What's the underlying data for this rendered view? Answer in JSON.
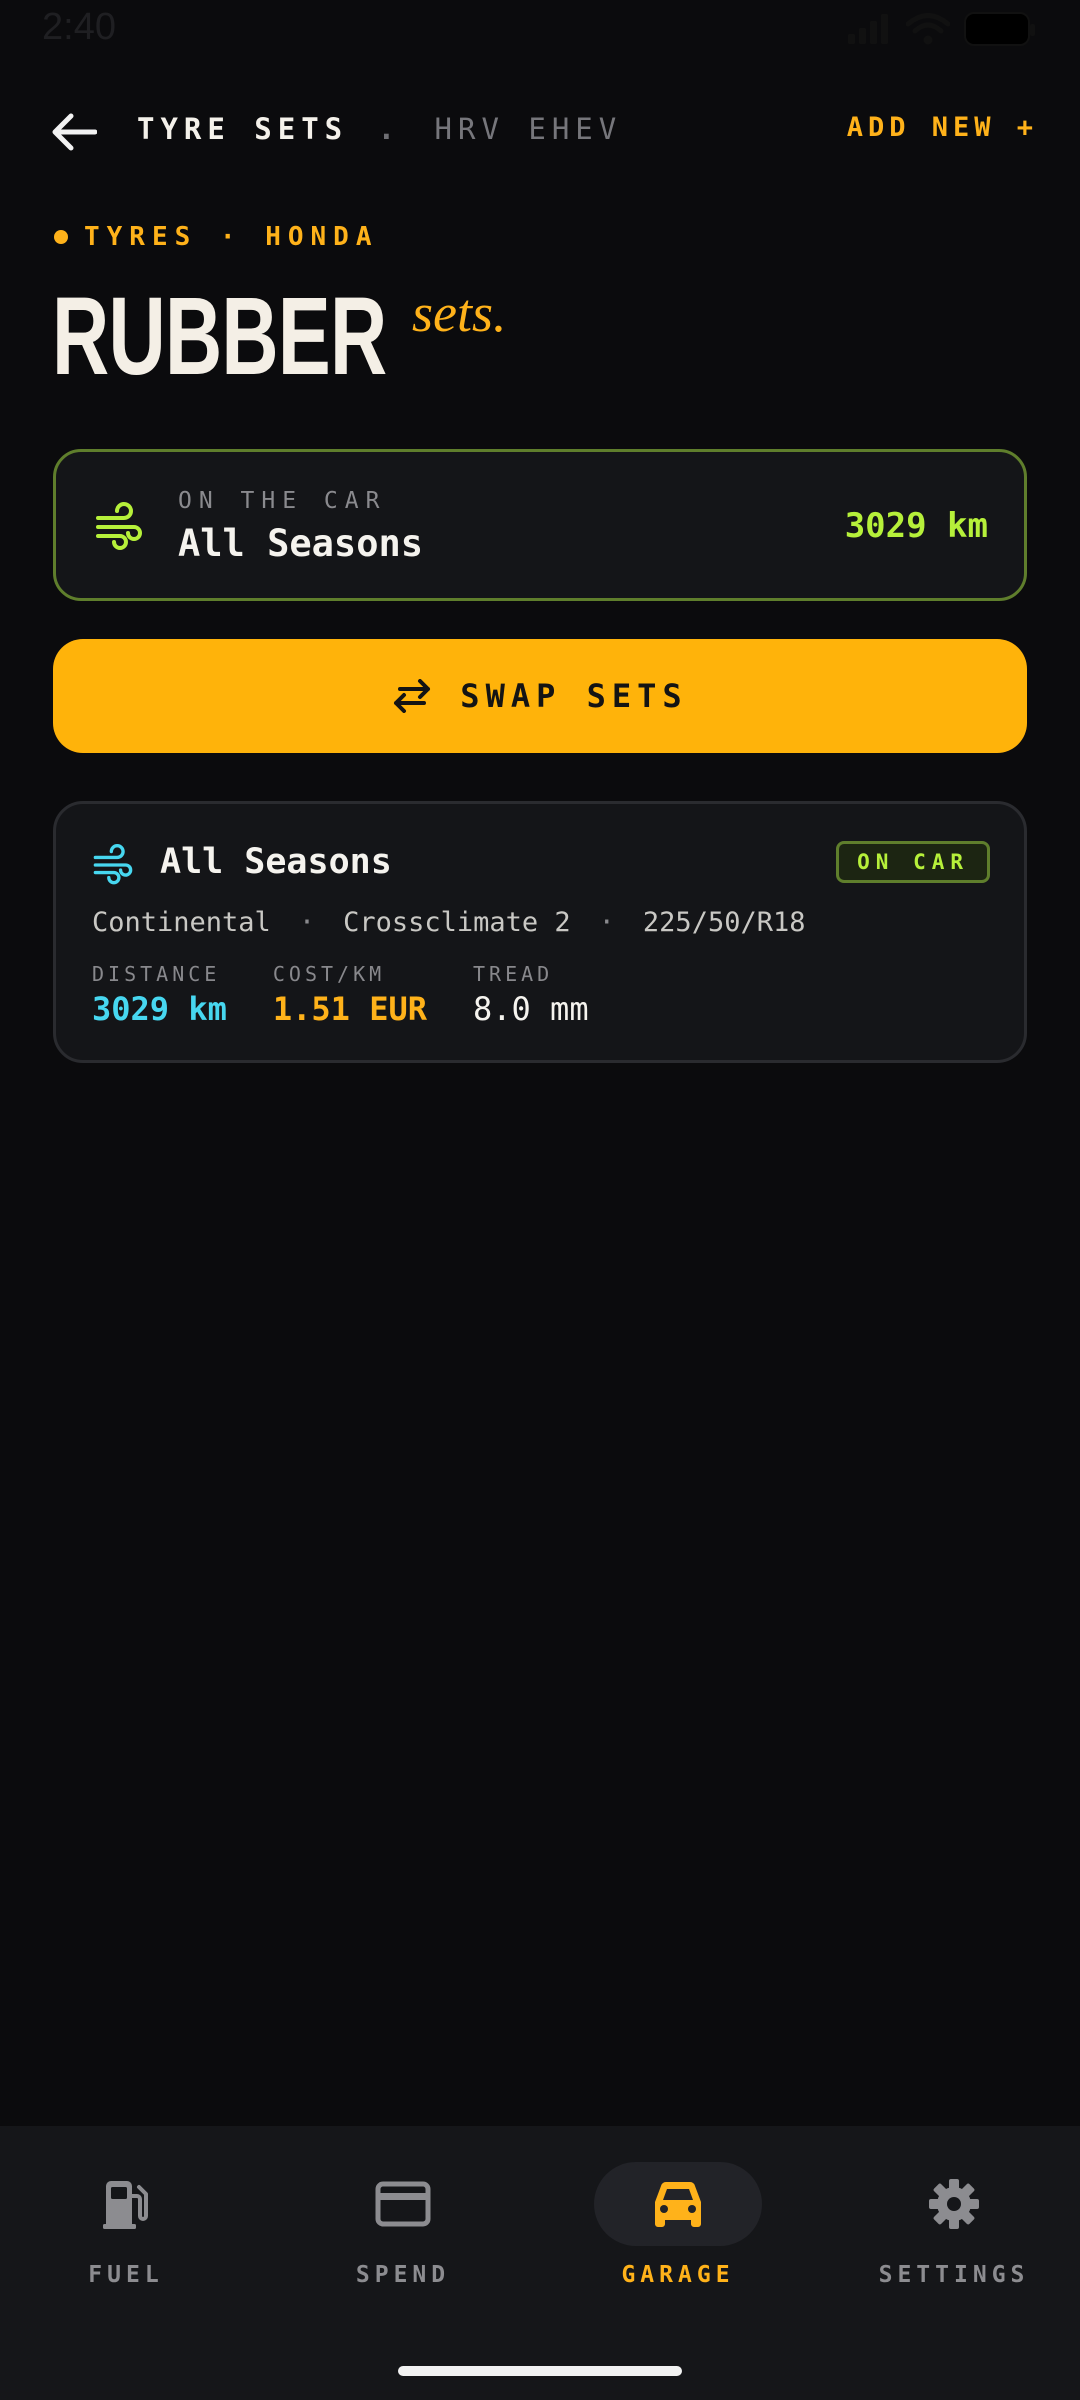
{
  "status_bar": {
    "time": "2:40"
  },
  "header": {
    "title": "TYRE SETS",
    "separator": ".",
    "vehicle": "HRV EHEV",
    "add_new": "ADD NEW +"
  },
  "eyebrow": "TYRES · HONDA",
  "page_title": {
    "main": "RUBBER",
    "script": "sets."
  },
  "current_set": {
    "label": "ON THE CAR",
    "name": "All Seasons",
    "distance": "3029 km",
    "icon": "wind-icon"
  },
  "swap_button": {
    "label": "SWAP SETS",
    "icon": "swap-arrows-icon"
  },
  "tyre_sets": [
    {
      "name": "All Seasons",
      "badge": "ON CAR",
      "brand": "Continental",
      "model": "Crossclimate 2",
      "size": "225/50/R18",
      "spec_separator": "·",
      "stats": [
        {
          "label": "DISTANCE",
          "value": "3029 km"
        },
        {
          "label": "COST/KM",
          "value": "1.51 EUR"
        },
        {
          "label": "TREAD",
          "value": "8.0 mm"
        }
      ]
    }
  ],
  "bottom_nav": [
    {
      "label": "FUEL",
      "icon": "fuel-pump-icon",
      "active": false
    },
    {
      "label": "SPEND",
      "icon": "card-icon",
      "active": false
    },
    {
      "label": "GARAGE",
      "icon": "car-icon",
      "active": true
    },
    {
      "label": "SETTINGS",
      "icon": "gear-icon",
      "active": false
    }
  ],
  "colors": {
    "accent": "#ffb30a",
    "on_car_green": "#b6f03a",
    "distance_cyan": "#47d7f0",
    "background": "#0b0b0d"
  }
}
